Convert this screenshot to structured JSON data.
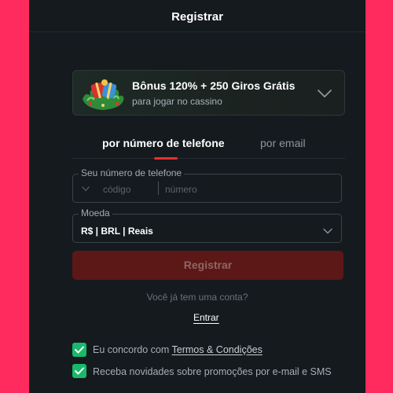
{
  "header": {
    "title": "Registrar"
  },
  "bonus": {
    "title": "Bônus 120% + 250 Giros Grátis",
    "subtitle": "para jogar no cassino",
    "icon": "gift-icon"
  },
  "tabs": [
    {
      "label": "por número de telefone",
      "active": true
    },
    {
      "label": "por email",
      "active": false
    }
  ],
  "phone_field": {
    "legend": "Seu número de telefone",
    "code_placeholder": "código",
    "number_placeholder": "número"
  },
  "currency_field": {
    "legend": "Moeda",
    "value": "R$ | BRL | Reais"
  },
  "register_button": {
    "label": "Registrar",
    "disabled": true
  },
  "login": {
    "prompt": "Você já tem uma conta?",
    "link": "Entrar"
  },
  "consents": {
    "terms_prefix": "Eu concordo com",
    "terms_link": "Termos & Condições",
    "terms_checked": true,
    "newsletter": "Receba novidades sobre promoções por e-mail e SMS",
    "newsletter_checked": true
  },
  "colors": {
    "background": "#ff2a5e",
    "panel": "#151a1f",
    "accent_red": "#e8302f",
    "button_disabled": "#5c1717",
    "checkbox_green": "#18b96b"
  }
}
